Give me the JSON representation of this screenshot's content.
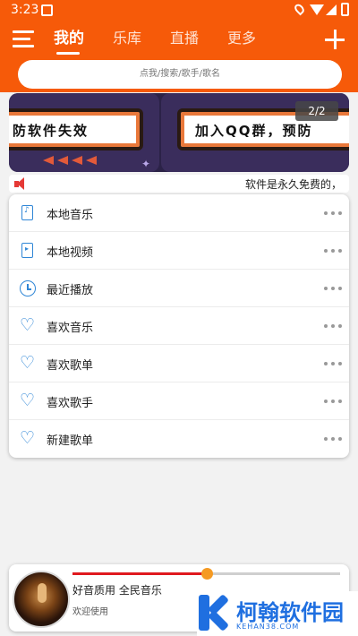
{
  "status_bar": {
    "time": "3:23"
  },
  "header": {
    "tabs": [
      {
        "label": "我的",
        "active": true
      },
      {
        "label": "乐库",
        "active": false
      },
      {
        "label": "直播",
        "active": false
      },
      {
        "label": "更多",
        "active": false
      }
    ],
    "menu_icon": "menu-icon",
    "add_icon": "plus-icon"
  },
  "search": {
    "placeholder": "点我/搜索/歌手/歌名"
  },
  "banner": {
    "left_text": "防软件失效",
    "right_text": "加入QQ群，预防",
    "pager": "2/2"
  },
  "marquee": {
    "text": "软件是永久免费的，"
  },
  "list": {
    "items": [
      {
        "label": "本地音乐",
        "icon": "phone-music-icon"
      },
      {
        "label": "本地视频",
        "icon": "phone-video-icon"
      },
      {
        "label": "最近播放",
        "icon": "clock-icon"
      },
      {
        "label": "喜欢音乐",
        "icon": "heart-icon"
      },
      {
        "label": "喜欢歌单",
        "icon": "heart-icon"
      },
      {
        "label": "喜欢歌手",
        "icon": "heart-icon"
      },
      {
        "label": "新建歌单",
        "icon": "heart-icon"
      }
    ]
  },
  "player": {
    "title": "好音质用 全民音乐",
    "subtitle": "欢迎使用",
    "progress": 0.5
  },
  "watermark": {
    "text": "柯翰软件园",
    "sub": "KEHAN38.COM"
  },
  "colors": {
    "accent": "#f65a09",
    "icon_blue": "#2f86d6",
    "progress_red": "#e0191e",
    "thumb": "#f59a23"
  }
}
